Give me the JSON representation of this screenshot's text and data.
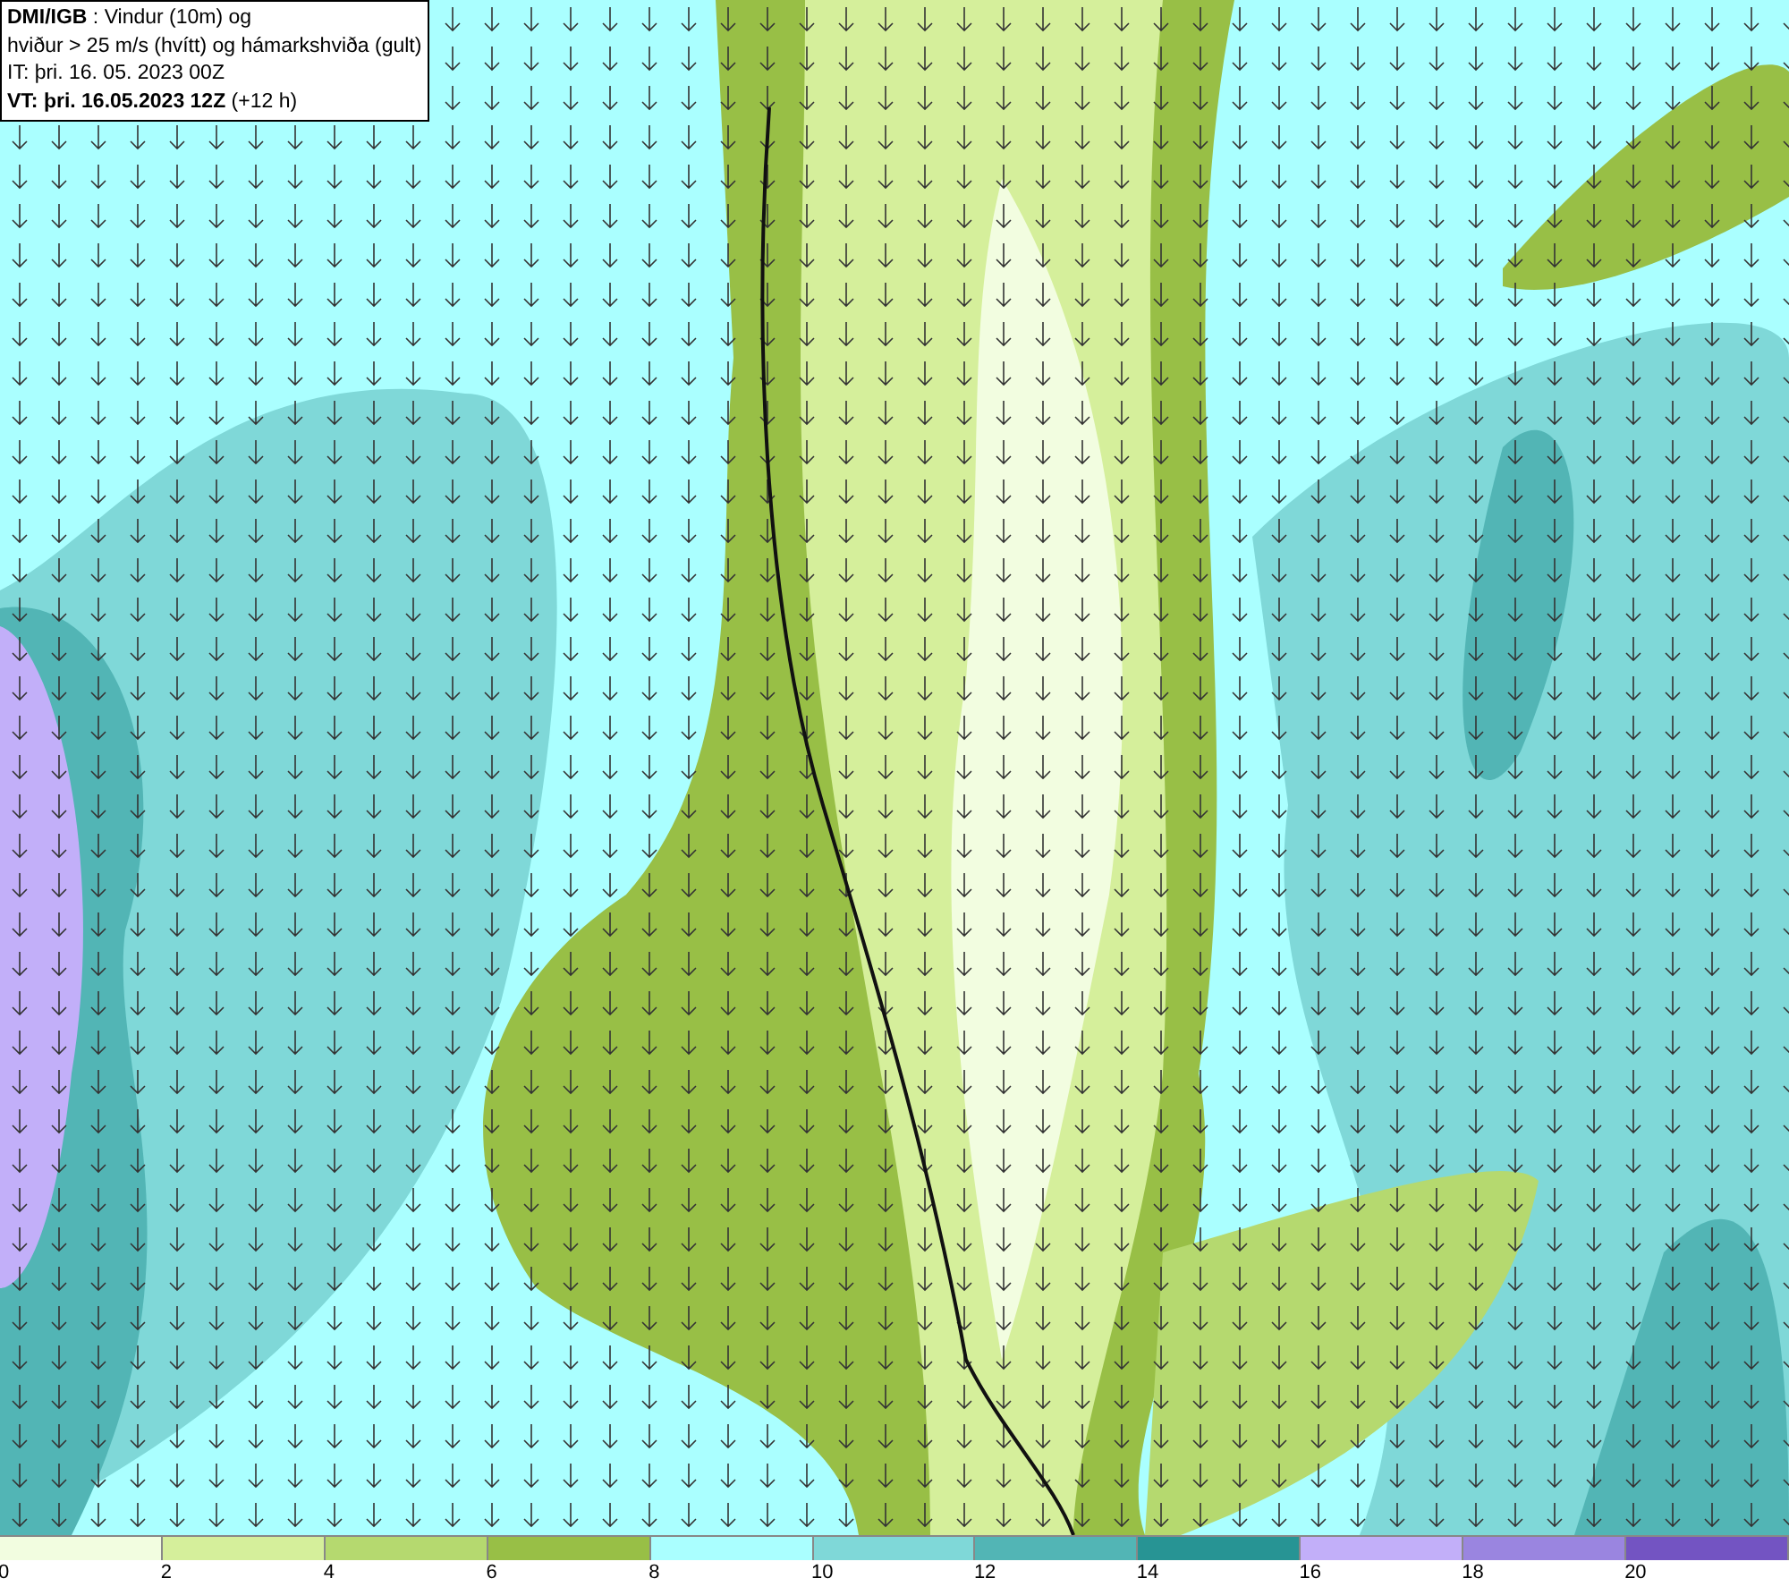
{
  "header": {
    "lines": [
      "**DMI/IGB** : Vindur (10m) og",
      "hviður > 25 m/s (hvítt) og hámarkshviða (gult)",
      "IT: þri. 16. 05. 2023 00Z",
      "**VT: þri. 16.05.2023 12Z** (+12 h)"
    ]
  },
  "legend": {
    "bins": [
      {
        "label": "0",
        "color": "#f2fde0"
      },
      {
        "label": "2",
        "color": "#d5ef9b"
      },
      {
        "label": "4",
        "color": "#b5d96f"
      },
      {
        "label": "6",
        "color": "#98bf46"
      },
      {
        "label": "8",
        "color": "#aaffff"
      },
      {
        "label": "10",
        "color": "#7fd8d8"
      },
      {
        "label": "12",
        "color": "#52b5b5"
      },
      {
        "label": "14",
        "color": "#279494"
      },
      {
        "label": "16",
        "color": "#c2aff9"
      },
      {
        "label": "18",
        "color": "#9a85e0"
      },
      {
        "label": "20",
        "color": "#7354c2"
      }
    ]
  }
}
